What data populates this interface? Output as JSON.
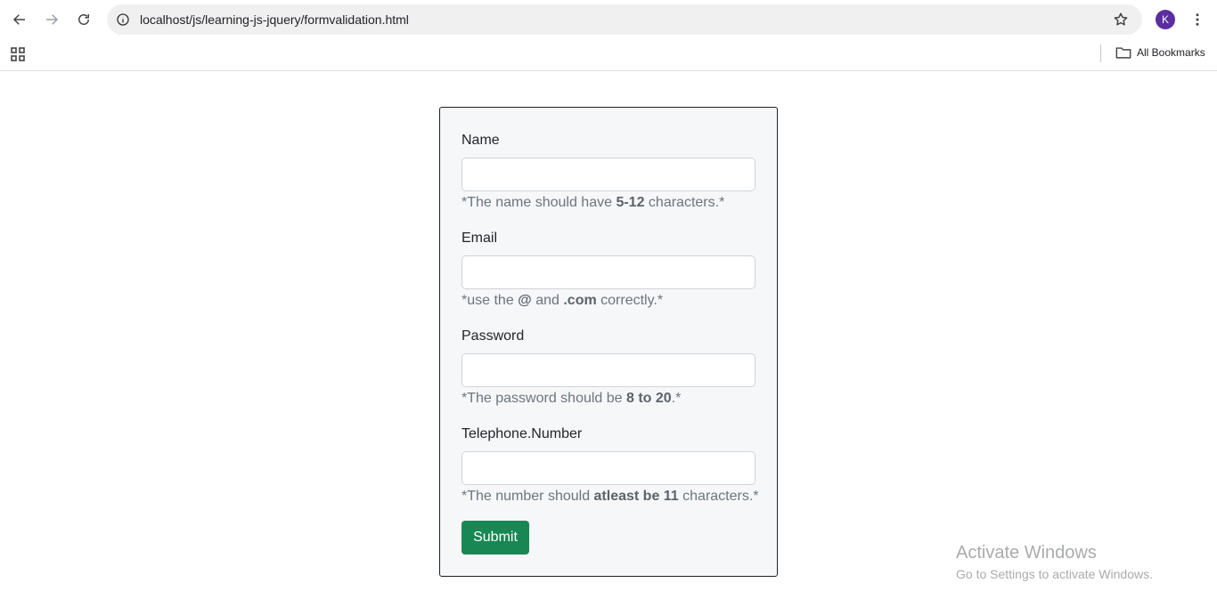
{
  "browser": {
    "url": "localhost/js/learning-js-jquery/formvalidation.html",
    "profile_initial": "K",
    "bookmarks_label": "All Bookmarks"
  },
  "form": {
    "name": {
      "label": "Name",
      "value": "",
      "hint_pre": "*The name should have ",
      "hint_bold": "5-12",
      "hint_post": " characters.*"
    },
    "email": {
      "label": "Email",
      "value": "",
      "hint_pre": "*use the ",
      "hint_bold1": "@",
      "hint_mid": " and ",
      "hint_bold2": ".com",
      "hint_post": " correctly.*"
    },
    "password": {
      "label": "Password",
      "value": "",
      "hint_pre": "*The password should be ",
      "hint_bold": "8 to 20",
      "hint_post": ".*"
    },
    "telephone": {
      "label": "Telephone.Number",
      "value": "",
      "hint_pre": "*The number should ",
      "hint_bold": "atleast be 11",
      "hint_post": " characters.*"
    },
    "submit_label": "Submit"
  },
  "watermark": {
    "title": "Activate Windows",
    "subtitle": "Go to Settings to activate Windows."
  },
  "colors": {
    "submit": "#198754",
    "avatar": "#5b2d9f"
  }
}
